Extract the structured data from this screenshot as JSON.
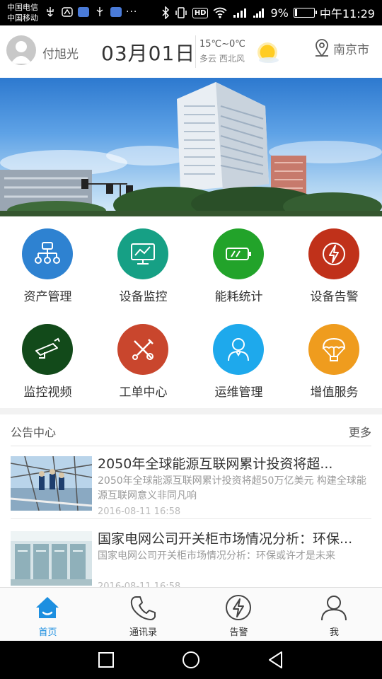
{
  "status_bar": {
    "carrier1": "中国电信",
    "carrier2": "中国移动",
    "battery": "9%",
    "time": "中午11:29",
    "hd_badge": "HD",
    "overflow": "···"
  },
  "header": {
    "user_name": "付旭光",
    "date": "03月01日",
    "temperature": "15℃~0℃",
    "weather": "多云 西北风",
    "city": "南京市"
  },
  "grid": [
    {
      "label": "资产管理",
      "icon": "asset-tree-icon",
      "color": "#2e82d1"
    },
    {
      "label": "设备监控",
      "icon": "monitor-chart-icon",
      "color": "#16a085"
    },
    {
      "label": "能耗统计",
      "icon": "battery-icon",
      "color": "#22a32a"
    },
    {
      "label": "设备告警",
      "icon": "lightning-alarm-icon",
      "color": "#c0311a"
    },
    {
      "label": "监控视频",
      "icon": "camera-icon",
      "color": "#124a1a"
    },
    {
      "label": "工单中心",
      "icon": "tools-icon",
      "color": "#c9462d"
    },
    {
      "label": "运维管理",
      "icon": "person-icon",
      "color": "#1ea9ec"
    },
    {
      "label": "增值服务",
      "icon": "parachute-icon",
      "color": "#ef9c1e"
    }
  ],
  "notice": {
    "title": "公告中心",
    "more": "更多",
    "items": [
      {
        "title": "2050年全球能源互联网累计投资将超...",
        "summary": "2050年全球能源互联网累计投资将超50万亿美元 构建全球能源互联网意义非同凡响",
        "time": "2016-08-11 16:58"
      },
      {
        "title": "国家电网公司开关柜市场情况分析：环保...",
        "summary": "国家电网公司开关柜市场情况分析：环保或许才是未来",
        "time": "2016-08-11 16:58"
      }
    ]
  },
  "tabs": [
    {
      "label": "首页",
      "icon": "home-icon",
      "active": true
    },
    {
      "label": "通讯录",
      "icon": "phone-icon",
      "active": false
    },
    {
      "label": "告警",
      "icon": "lightning-icon",
      "active": false
    },
    {
      "label": "我",
      "icon": "user-icon",
      "active": false
    }
  ],
  "colors": {
    "accent": "#1d8fe0"
  }
}
